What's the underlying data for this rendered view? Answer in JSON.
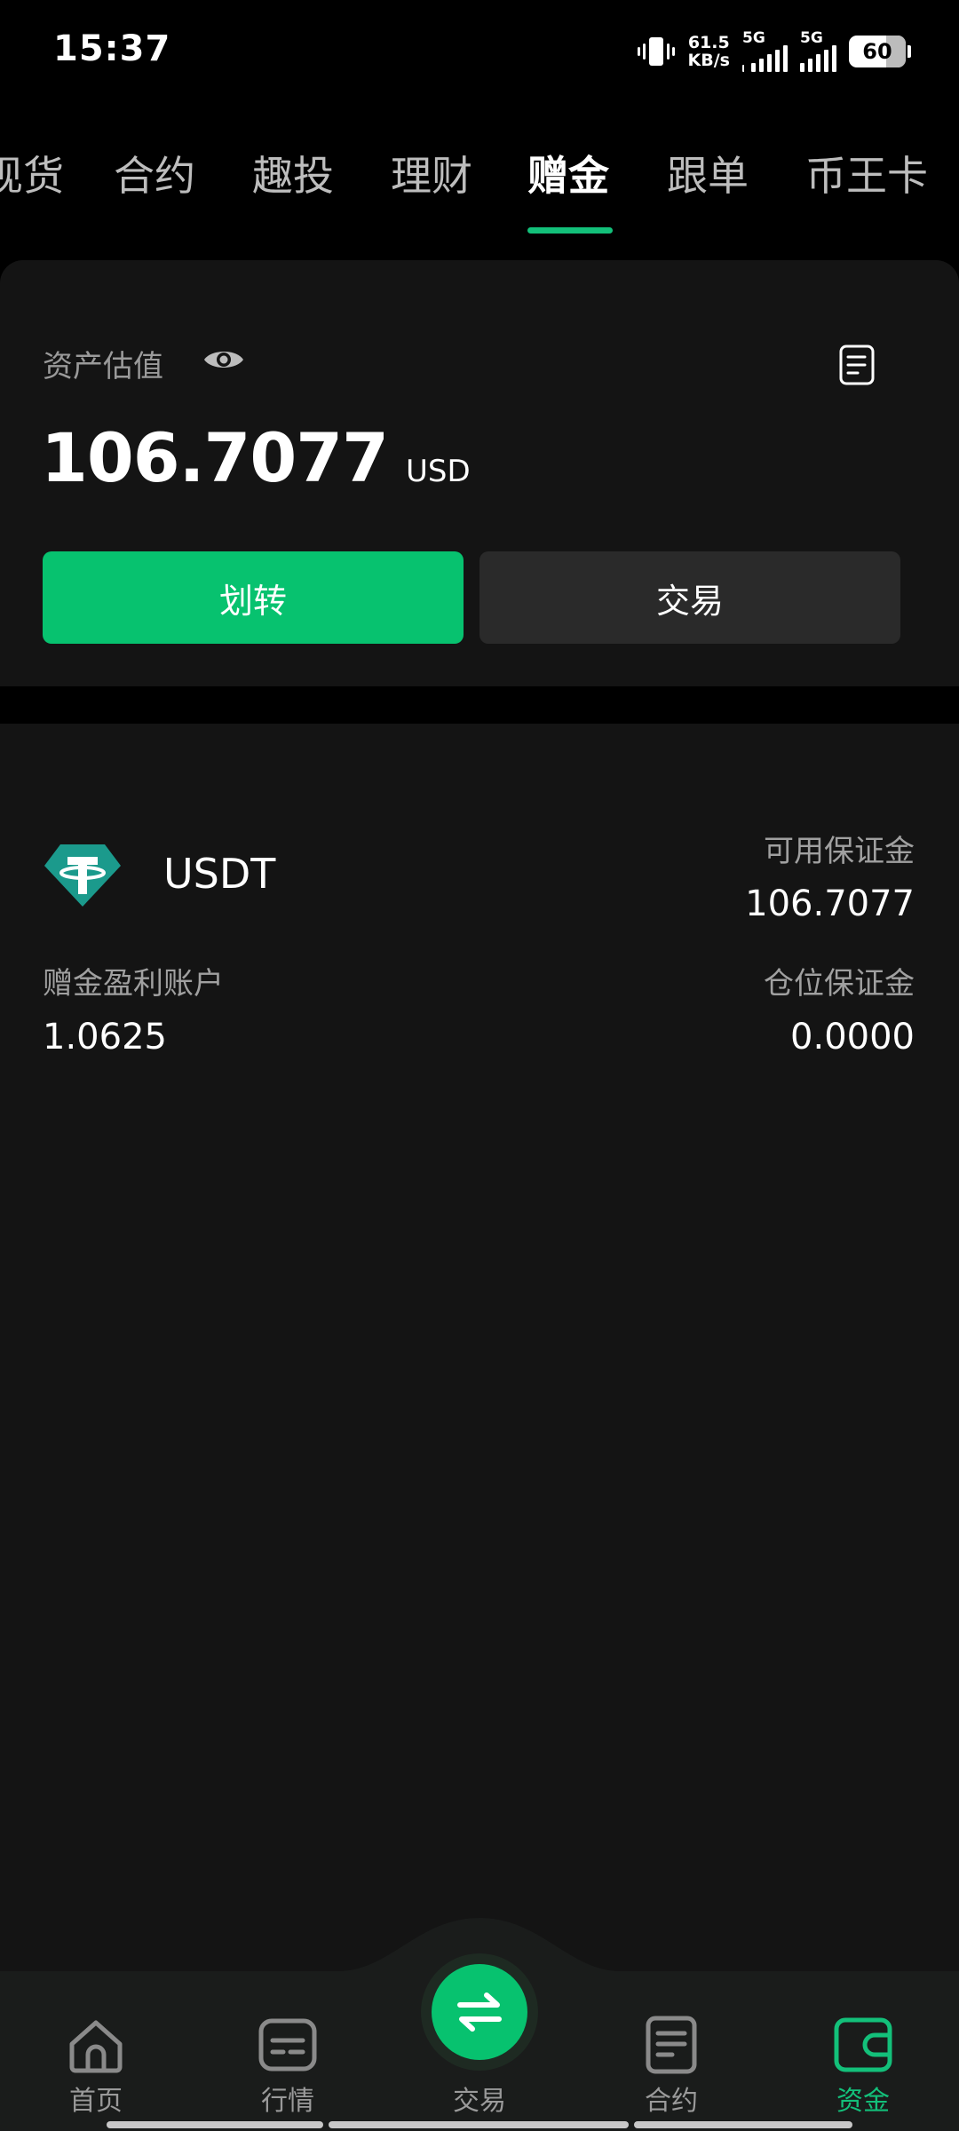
{
  "status_bar": {
    "time": "15:37",
    "net_speed_value": "61.5",
    "net_speed_unit": "KB/s",
    "signal1_label": "5G",
    "signal2_label": "5G",
    "battery": "60"
  },
  "top_tabs": {
    "items": [
      "现货",
      "合约",
      "趣投",
      "理财",
      "赠金",
      "跟单",
      "币王卡"
    ],
    "active": "赠金"
  },
  "asset": {
    "label": "资产估值",
    "value": "106.7077",
    "unit": "USD",
    "transfer_label": "划转",
    "trade_label": "交易"
  },
  "account": {
    "coin": "USDT",
    "available_margin_label": "可用保证金",
    "available_margin_value": "106.7077",
    "bonus_profit_label": "赠金盈利账户",
    "bonus_profit_value": "1.0625",
    "position_margin_label": "仓位保证金",
    "position_margin_value": "0.0000"
  },
  "bottom_nav": {
    "items": [
      {
        "label": "首页",
        "icon": "home-icon"
      },
      {
        "label": "行情",
        "icon": "market-icon"
      },
      {
        "label": "交易",
        "icon": "swap-icon"
      },
      {
        "label": "合约",
        "icon": "contract-icon"
      },
      {
        "label": "资金",
        "icon": "wallet-icon"
      }
    ],
    "active": "资金"
  },
  "colors": {
    "accent": "#07c26f",
    "background": "#141414",
    "tether": "#1b9a8c"
  }
}
